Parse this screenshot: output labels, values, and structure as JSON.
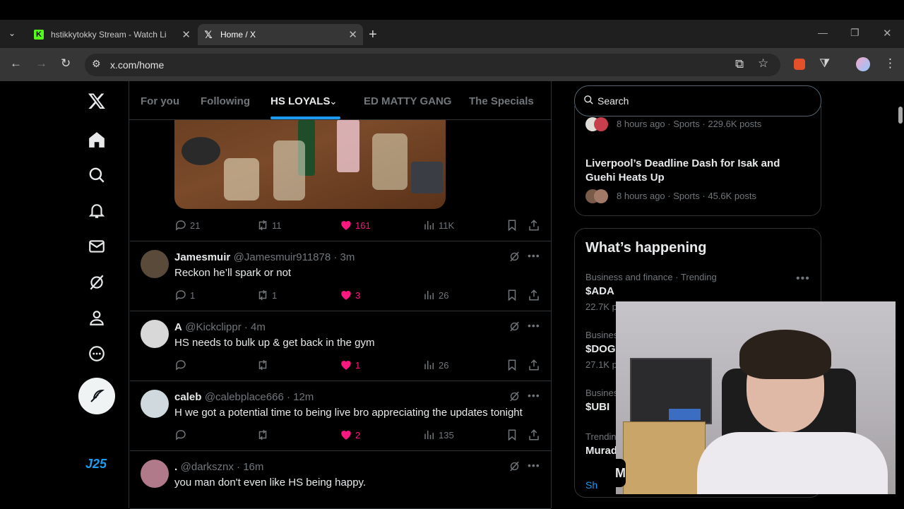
{
  "browser": {
    "tabs": [
      {
        "title": "hstikkytokky Stream - Watch Li",
        "favicon": "kick-icon",
        "active": false
      },
      {
        "title": "Home / X",
        "favicon": "x-icon",
        "active": true
      }
    ],
    "address": "x.com/home"
  },
  "feed_tabs": [
    "For you",
    "Following",
    "HS LOYALS",
    "ED MATTY GANG",
    "The Specials"
  ],
  "active_feed_tab": "HS LOYALS",
  "media_post": {
    "replies": "21",
    "reposts": "11",
    "likes": "161",
    "views": "11K"
  },
  "posts": [
    {
      "name": "Jamesmuir",
      "handle": "@Jamesmuir911878 · 3m",
      "text": "Reckon he’ll spark or not",
      "replies": "1",
      "reposts": "1",
      "likes": "3",
      "views": "26"
    },
    {
      "name": "A",
      "handle": "@Kickclippr · 4m",
      "text": "HS needs to bulk up & get back in the gym",
      "replies": "",
      "reposts": "",
      "likes": "1",
      "views": "26"
    },
    {
      "name": "caleb",
      "handle": "@calebplace666 · 12m",
      "text": "H we got a potential time to being live bro appreciating the updates tonight",
      "replies": "",
      "reposts": "",
      "likes": "2",
      "views": "135"
    },
    {
      "name": ".",
      "handle": "@darksznx · 16m",
      "text": "you man don't even like HS being happy.",
      "replies": "",
      "reposts": "",
      "likes": "",
      "views": ""
    }
  ],
  "sidebar": {
    "nav_badge": "J25"
  },
  "search": {
    "placeholder": "Search"
  },
  "trending_top": [
    {
      "meta": "8 hours ago · Sports · 229.6K posts"
    },
    {
      "title": "Liverpool’s Deadline Dash for Isak and Guehi Heats Up",
      "meta": "8 hours ago · Sports · 45.6K posts"
    }
  ],
  "whats_happening": {
    "title": "What’s happening",
    "items": [
      {
        "meta": "Business and finance · Trending",
        "title": "$ADA",
        "count": "22.7K p"
      },
      {
        "meta": "Busines",
        "title": "$DOGE",
        "count": "27.1K p"
      },
      {
        "meta": "Busines",
        "title": "$UBI",
        "count": ""
      },
      {
        "meta": "Trendin",
        "title": "Murad",
        "count": ""
      }
    ],
    "show_more": "Sh"
  },
  "colors": {
    "like": "#f91880",
    "accent": "#1d9bf0",
    "muted": "#71767b"
  }
}
